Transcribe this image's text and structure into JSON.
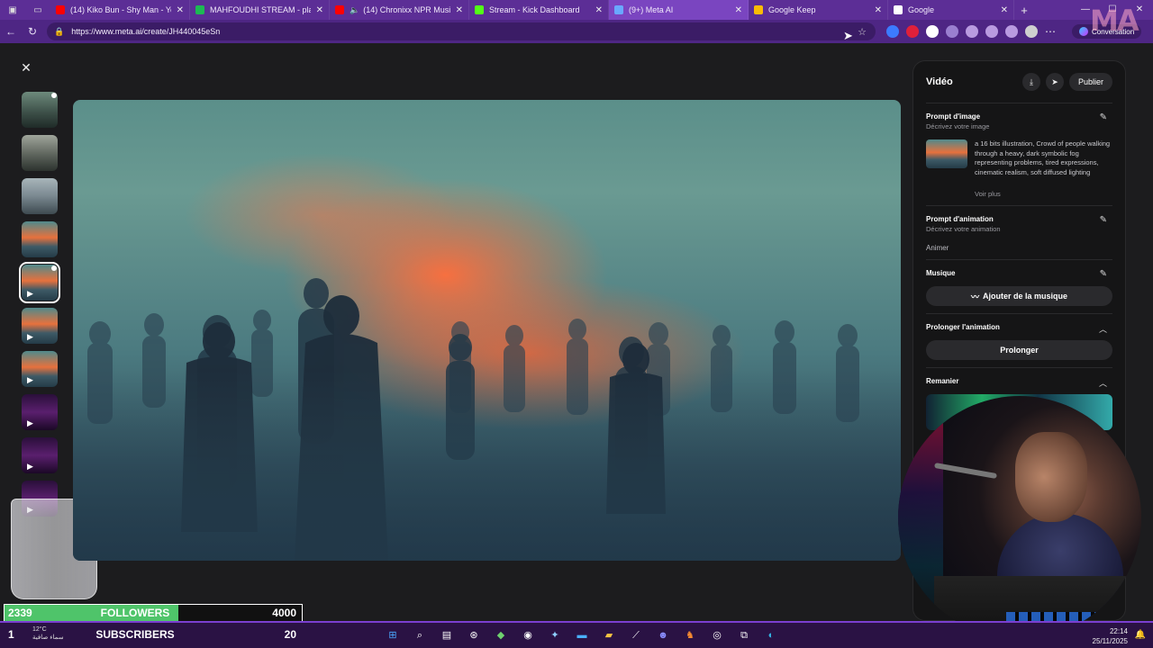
{
  "tabs": [
    {
      "title": "(14) Kiko Bun - Shy Man - YouTu",
      "favicon_color": "#ff0000",
      "favicon": "youtube-icon"
    },
    {
      "title": "MAHFOUDHI STREAM - playlist",
      "favicon_color": "#1db954",
      "favicon": "spotify-icon"
    },
    {
      "title": "(14) Chronixx NPR Music T",
      "favicon_color": "#ff0000",
      "favicon": "youtube-icon",
      "muted_icon": "🔈"
    },
    {
      "title": "Stream - Kick Dashboard",
      "favicon_color": "#53fc18",
      "favicon": "kick-icon"
    },
    {
      "title": "(9+) Meta AI",
      "favicon_color": "#6aa8ff",
      "favicon": "meta-ai-icon",
      "active": true
    },
    {
      "title": "Google Keep",
      "favicon_color": "#fbbc04",
      "favicon": "keep-icon"
    },
    {
      "title": "Google",
      "favicon_color": "#ffffff",
      "favicon": "google-icon"
    }
  ],
  "address": {
    "url": "https://www.meta.ai/create/JH440045eSn"
  },
  "conversation_label": "Conversation",
  "thumbnails": [
    {
      "style": "t-fog",
      "video": false,
      "dot": true
    },
    {
      "style": "t-fog2",
      "video": false
    },
    {
      "style": "t-fog3",
      "video": false
    },
    {
      "style": "t-fire",
      "video": false
    },
    {
      "style": "t-fire",
      "video": true,
      "selected": true,
      "dot": true
    },
    {
      "style": "t-fire",
      "video": true
    },
    {
      "style": "t-fire",
      "video": true
    },
    {
      "style": "t-purple",
      "video": true
    },
    {
      "style": "t-purple",
      "video": true
    },
    {
      "style": "t-purple",
      "video": true
    }
  ],
  "panel": {
    "title": "Vidéo",
    "publish": "Publier",
    "image_prompt": {
      "heading": "Prompt d'image",
      "sub": "Décrivez votre image",
      "text": "a 16 bits illustration, Crowd of people walking through a heavy, dark symbolic fog representing problems, tired expressions, cinematic realism, soft diffused lighting",
      "more": "Voir plus"
    },
    "anim_prompt": {
      "heading": "Prompt d'animation",
      "sub": "Décrivez votre animation",
      "action": "Animer"
    },
    "music": {
      "heading": "Musique",
      "button": "Ajouter de la musique"
    },
    "extend": {
      "heading": "Prolonger l'animation",
      "button": "Prolonger"
    },
    "remix": {
      "heading": "Remanier"
    }
  },
  "stats": {
    "followers": {
      "current": "2339",
      "label": "FOLLOWERS",
      "goal": "4000",
      "progress_fraction": 0.5848,
      "color": "#4fc46a"
    },
    "subscribers": {
      "current": "1",
      "label": "SUBSCRIBERS",
      "goal": "20",
      "progress_fraction": 0.05
    }
  },
  "taskbar": {
    "weather_temp": "12°C",
    "weather_desc": "سماء صافية",
    "time": "22:14",
    "date": "25/11/2025"
  }
}
